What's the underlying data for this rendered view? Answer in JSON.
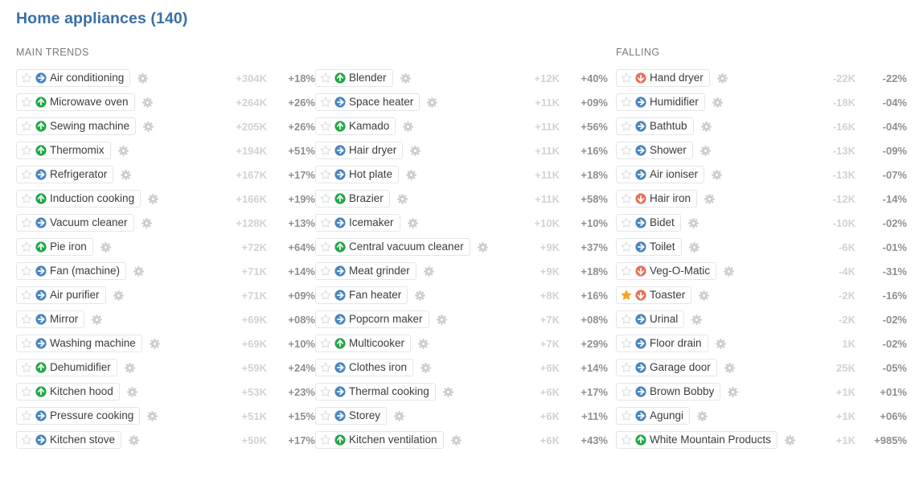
{
  "header": {
    "title": "Home appliances (140)",
    "title_color": "#3b6fa8"
  },
  "sections": {
    "main_label": "MAIN TRENDS",
    "falling_label": "FALLING"
  },
  "colors": {
    "rising": "#22a845",
    "stable": "#4a86bf",
    "falling": "#e8705a",
    "star_active": "#f5a623",
    "star_inactive": "#d8dce0",
    "gear": "#cdcdcd",
    "volume_text": "#d2d2d2",
    "percent_text": "#8f8f8f"
  },
  "icons": {
    "star": "star-icon",
    "gear": "gear-icon",
    "rising": "arrow-up-circle-icon",
    "stable": "arrow-right-circle-icon",
    "falling": "arrow-down-circle-icon"
  },
  "columns": {
    "main_1": [
      {
        "label": "Air conditioning",
        "trend": "stable",
        "starred": false,
        "volume": "+304K",
        "percent": "+18%"
      },
      {
        "label": "Microwave oven",
        "trend": "rising",
        "starred": false,
        "volume": "+264K",
        "percent": "+26%"
      },
      {
        "label": "Sewing machine",
        "trend": "rising",
        "starred": false,
        "volume": "+205K",
        "percent": "+26%"
      },
      {
        "label": "Thermomix",
        "trend": "rising",
        "starred": false,
        "volume": "+194K",
        "percent": "+51%"
      },
      {
        "label": "Refrigerator",
        "trend": "stable",
        "starred": false,
        "volume": "+167K",
        "percent": "+17%"
      },
      {
        "label": "Induction cooking",
        "trend": "rising",
        "starred": false,
        "volume": "+166K",
        "percent": "+19%"
      },
      {
        "label": "Vacuum cleaner",
        "trend": "stable",
        "starred": false,
        "volume": "+128K",
        "percent": "+13%"
      },
      {
        "label": "Pie iron",
        "trend": "rising",
        "starred": false,
        "volume": "+72K",
        "percent": "+64%"
      },
      {
        "label": "Fan (machine)",
        "trend": "stable",
        "starred": false,
        "volume": "+71K",
        "percent": "+14%"
      },
      {
        "label": "Air purifier",
        "trend": "stable",
        "starred": false,
        "volume": "+71K",
        "percent": "+09%"
      },
      {
        "label": "Mirror",
        "trend": "stable",
        "starred": false,
        "volume": "+69K",
        "percent": "+08%"
      },
      {
        "label": "Washing machine",
        "trend": "stable",
        "starred": false,
        "volume": "+69K",
        "percent": "+10%"
      },
      {
        "label": "Dehumidifier",
        "trend": "rising",
        "starred": false,
        "volume": "+59K",
        "percent": "+24%"
      },
      {
        "label": "Kitchen hood",
        "trend": "rising",
        "starred": false,
        "volume": "+53K",
        "percent": "+23%"
      },
      {
        "label": "Pressure cooking",
        "trend": "stable",
        "starred": false,
        "volume": "+51K",
        "percent": "+15%"
      },
      {
        "label": "Kitchen stove",
        "trend": "stable",
        "starred": false,
        "volume": "+50K",
        "percent": "+17%"
      }
    ],
    "main_2": [
      {
        "label": "Blender",
        "trend": "rising",
        "starred": false,
        "volume": "+12K",
        "percent": "+40%"
      },
      {
        "label": "Space heater",
        "trend": "stable",
        "starred": false,
        "volume": "+11K",
        "percent": "+09%"
      },
      {
        "label": "Kamado",
        "trend": "rising",
        "starred": false,
        "volume": "+11K",
        "percent": "+56%"
      },
      {
        "label": "Hair dryer",
        "trend": "stable",
        "starred": false,
        "volume": "+11K",
        "percent": "+16%"
      },
      {
        "label": "Hot plate",
        "trend": "stable",
        "starred": false,
        "volume": "+11K",
        "percent": "+18%"
      },
      {
        "label": "Brazier",
        "trend": "rising",
        "starred": false,
        "volume": "+11K",
        "percent": "+58%"
      },
      {
        "label": "Icemaker",
        "trend": "stable",
        "starred": false,
        "volume": "+10K",
        "percent": "+10%"
      },
      {
        "label": "Central vacuum cleaner",
        "trend": "rising",
        "starred": false,
        "volume": "+9K",
        "percent": "+37%"
      },
      {
        "label": "Meat grinder",
        "trend": "stable",
        "starred": false,
        "volume": "+9K",
        "percent": "+18%"
      },
      {
        "label": "Fan heater",
        "trend": "stable",
        "starred": false,
        "volume": "+8K",
        "percent": "+16%"
      },
      {
        "label": "Popcorn maker",
        "trend": "stable",
        "starred": false,
        "volume": "+7K",
        "percent": "+08%"
      },
      {
        "label": "Multicooker",
        "trend": "rising",
        "starred": false,
        "volume": "+7K",
        "percent": "+29%"
      },
      {
        "label": "Clothes iron",
        "trend": "stable",
        "starred": false,
        "volume": "+6K",
        "percent": "+14%"
      },
      {
        "label": "Thermal cooking",
        "trend": "stable",
        "starred": false,
        "volume": "+6K",
        "percent": "+17%"
      },
      {
        "label": "Storey",
        "trend": "stable",
        "starred": false,
        "volume": "+6K",
        "percent": "+11%"
      },
      {
        "label": "Kitchen ventilation",
        "trend": "rising",
        "starred": false,
        "volume": "+6K",
        "percent": "+43%"
      }
    ],
    "falling_1": [
      {
        "label": "Hand dryer",
        "trend": "falling",
        "starred": false,
        "volume": "-22K",
        "percent": "-22%"
      },
      {
        "label": "Humidifier",
        "trend": "stable",
        "starred": false,
        "volume": "-18K",
        "percent": "-04%"
      },
      {
        "label": "Bathtub",
        "trend": "stable",
        "starred": false,
        "volume": "-16K",
        "percent": "-04%"
      },
      {
        "label": "Shower",
        "trend": "stable",
        "starred": false,
        "volume": "-13K",
        "percent": "-09%"
      },
      {
        "label": "Air ioniser",
        "trend": "stable",
        "starred": false,
        "volume": "-13K",
        "percent": "-07%"
      },
      {
        "label": "Hair iron",
        "trend": "falling",
        "starred": false,
        "volume": "-12K",
        "percent": "-14%"
      },
      {
        "label": "Bidet",
        "trend": "stable",
        "starred": false,
        "volume": "-10K",
        "percent": "-02%"
      },
      {
        "label": "Toilet",
        "trend": "stable",
        "starred": false,
        "volume": "-6K",
        "percent": "-01%"
      },
      {
        "label": "Veg-O-Matic",
        "trend": "falling",
        "starred": false,
        "volume": "-4K",
        "percent": "-31%"
      },
      {
        "label": "Toaster",
        "trend": "falling",
        "starred": true,
        "volume": "-2K",
        "percent": "-16%"
      },
      {
        "label": "Urinal",
        "trend": "stable",
        "starred": false,
        "volume": "-2K",
        "percent": "-02%"
      },
      {
        "label": "Floor drain",
        "trend": "stable",
        "starred": false,
        "volume": "1K",
        "percent": "-02%"
      },
      {
        "label": "Garage door",
        "trend": "stable",
        "starred": false,
        "volume": "25K",
        "percent": "-05%"
      },
      {
        "label": "Brown Bobby",
        "trend": "stable",
        "starred": false,
        "volume": "+1K",
        "percent": "+01%"
      },
      {
        "label": "Agungi",
        "trend": "stable",
        "starred": false,
        "volume": "+1K",
        "percent": "+06%"
      },
      {
        "label": "White Mountain Products",
        "trend": "rising",
        "starred": false,
        "volume": "+1K",
        "percent": "+985%"
      }
    ]
  }
}
